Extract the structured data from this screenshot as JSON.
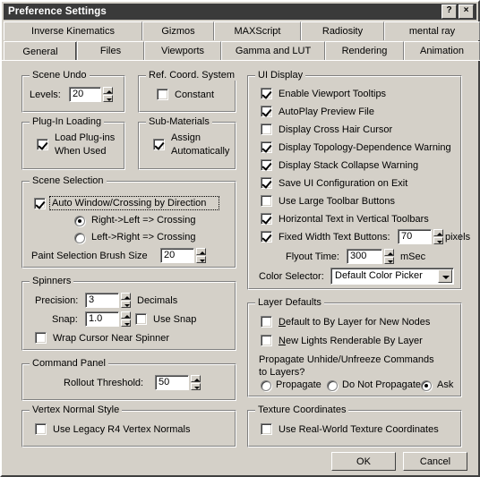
{
  "window": {
    "title": "Preference Settings",
    "help_button": "?",
    "close_button": "×"
  },
  "tabs": {
    "row1": [
      {
        "label": "Inverse Kinematics",
        "selected": false
      },
      {
        "label": "Gizmos",
        "selected": false
      },
      {
        "label": "MAXScript",
        "selected": false
      },
      {
        "label": "Radiosity",
        "selected": false
      },
      {
        "label": "mental ray",
        "selected": false
      }
    ],
    "row2": [
      {
        "label": "General",
        "selected": true
      },
      {
        "label": "Files",
        "selected": false
      },
      {
        "label": "Viewports",
        "selected": false
      },
      {
        "label": "Gamma and LUT",
        "selected": false
      },
      {
        "label": "Rendering",
        "selected": false
      },
      {
        "label": "Animation",
        "selected": false
      }
    ]
  },
  "scene_undo": {
    "title": "Scene Undo",
    "levels_label": "Levels:",
    "levels_value": "20"
  },
  "ref_coord": {
    "title": "Ref. Coord. System",
    "constant_label": "Constant",
    "constant_checked": false
  },
  "plugin_loading": {
    "title": "Plug-In Loading",
    "load_label_line1": "Load Plug-ins",
    "load_label_line2": "When Used",
    "load_checked": true
  },
  "sub_materials": {
    "title": "Sub-Materials",
    "assign_label_line1": "Assign",
    "assign_label_line2": "Automatically",
    "assign_checked": true
  },
  "scene_selection": {
    "title": "Scene Selection",
    "auto_label": "Auto Window/Crossing by Direction",
    "auto_checked": true,
    "radio_right_left": "Right->Left => Crossing",
    "radio_left_right": "Left->Right => Crossing",
    "radio_selected": "Right->Left => Crossing",
    "brush_label": "Paint Selection Brush Size",
    "brush_value": "20"
  },
  "spinners": {
    "title": "Spinners",
    "precision_label": "Precision:",
    "precision_value": "3",
    "decimals_label": "Decimals",
    "snap_label": "Snap:",
    "snap_value": "1.0",
    "use_snap_label": "Use Snap",
    "use_snap_checked": false,
    "wrap_label": "Wrap Cursor Near Spinner",
    "wrap_checked": false
  },
  "command_panel": {
    "title": "Command Panel",
    "rollout_label": "Rollout Threshold:",
    "rollout_value": "50"
  },
  "vertex_normal": {
    "title": "Vertex Normal Style",
    "legacy_label": "Use Legacy R4 Vertex Normals",
    "legacy_checked": false
  },
  "ui_display": {
    "title": "UI Display",
    "checkboxes": [
      {
        "label": "Enable Viewport Tooltips",
        "checked": true
      },
      {
        "label": "AutoPlay Preview File",
        "checked": true
      },
      {
        "label": "Display Cross Hair Cursor",
        "checked": false
      },
      {
        "label": "Display Topology-Dependence Warning",
        "checked": true
      },
      {
        "label": "Display Stack Collapse Warning",
        "checked": true
      },
      {
        "label": "Save UI Configuration on Exit",
        "checked": true
      },
      {
        "label": "Use Large Toolbar Buttons",
        "checked": false
      },
      {
        "label": "Horizontal Text in Vertical Toolbars",
        "checked": true
      }
    ],
    "fixed_width_label": "Fixed Width Text Buttons:",
    "fixed_width_checked": true,
    "fixed_width_value": "70",
    "pixels_label": "pixels",
    "flyout_label": "Flyout Time:",
    "flyout_value": "300",
    "msec_label": "mSec",
    "color_selector_label": "Color Selector:",
    "color_selector_value": "Default Color Picker"
  },
  "layer_defaults": {
    "title": "Layer Defaults",
    "default_bylayer_accel": "D",
    "default_bylayer_rest": "efault to By Layer for New Nodes",
    "default_bylayer_checked": false,
    "new_lights_accel": "N",
    "new_lights_rest": "ew Lights Renderable By Layer",
    "new_lights_checked": false,
    "propagate_line1": "Propagate Unhide/Unfreeze Commands",
    "propagate_line2": "to Layers?",
    "radio_propagate": "Propagate",
    "radio_do_not": "Do Not Propagate",
    "radio_ask": "Ask",
    "radio_selected": "Ask"
  },
  "texture_coords": {
    "title": "Texture Coordinates",
    "realworld_label": "Use Real-World Texture Coordinates",
    "realworld_checked": false
  },
  "footer": {
    "ok_label": "OK",
    "cancel_label": "Cancel"
  },
  "colors": {
    "face": "#d4d0c8",
    "titlebar": "#3a3a3a",
    "field": "#ffffff"
  }
}
